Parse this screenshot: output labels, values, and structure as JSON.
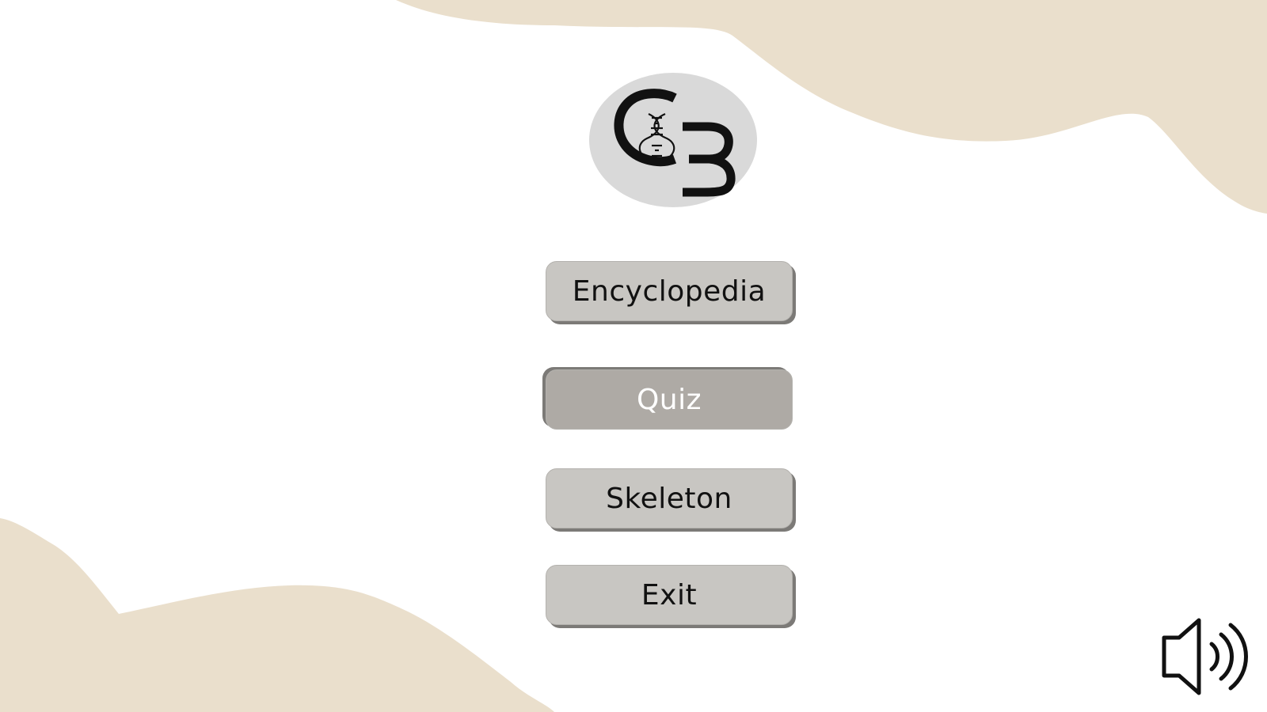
{
  "app": {
    "title": "C3"
  },
  "colors": {
    "background": "#ffffff",
    "accent_shape": "#eadfcc",
    "button_fill": "#c8c6c2",
    "button_selected_fill": "#aeaaa5",
    "button_shadow": "#7c7a77",
    "logo_circle": "#d9d9d9",
    "text_dark": "#111111",
    "text_selected": "#ffffff"
  },
  "logo": {
    "text": "C3",
    "icon": "dna-icon"
  },
  "menu": {
    "items": [
      {
        "label": "Encyclopedia",
        "selected": false
      },
      {
        "label": "Quiz",
        "selected": true
      },
      {
        "label": "Skeleton",
        "selected": false
      },
      {
        "label": "Exit",
        "selected": false
      }
    ]
  },
  "sound": {
    "icon": "speaker-volume-icon",
    "state": "on"
  }
}
